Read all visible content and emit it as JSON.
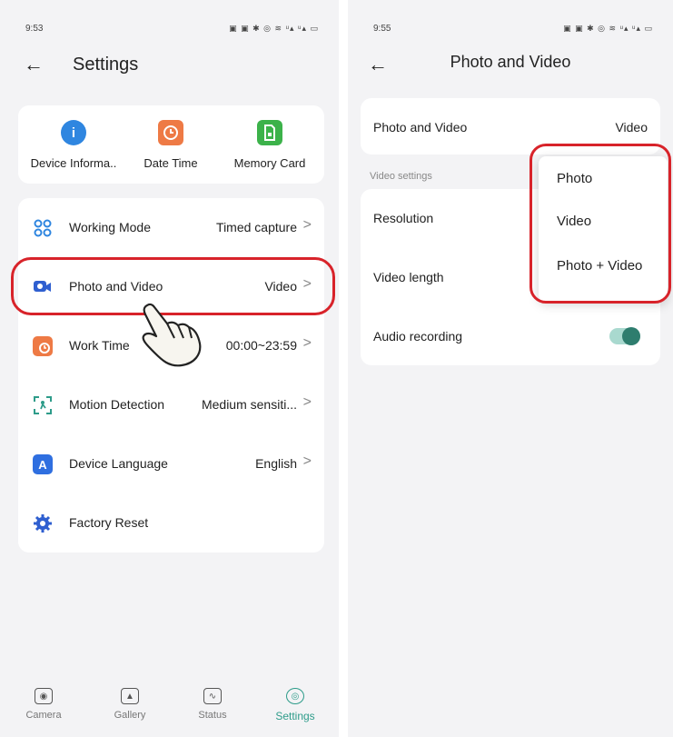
{
  "left": {
    "status": {
      "time": "9:53",
      "icons": "▣ ▣ ✱ ◎ ≋ ᵘ▴ ᵘ▴ ▭"
    },
    "header": {
      "title": "Settings"
    },
    "shortcuts": [
      {
        "label": "Device Informa..",
        "icon": "info-icon",
        "color": "#2f86e0"
      },
      {
        "label": "Date Time",
        "icon": "clock-icon",
        "color": "#ee7a45"
      },
      {
        "label": "Memory Card",
        "icon": "sd-card-icon",
        "color": "#3cb24a"
      }
    ],
    "rows": [
      {
        "label": "Working Mode",
        "value": "Timed capture",
        "icon": "grid-icon"
      },
      {
        "label": "Photo and Video",
        "value": "Video",
        "icon": "camera-icon"
      },
      {
        "label": "Work Time",
        "value": "00:00~23:59",
        "icon": "schedule-icon"
      },
      {
        "label": "Motion Detection",
        "value": "Medium sensiti...",
        "icon": "motion-icon"
      },
      {
        "label": "Device Language",
        "value": "English",
        "icon": "language-icon"
      },
      {
        "label": "Factory Reset",
        "value": "",
        "icon": "reset-gear-icon"
      }
    ],
    "nav": [
      {
        "label": "Camera",
        "icon": "camera-icon"
      },
      {
        "label": "Gallery",
        "icon": "gallery-icon"
      },
      {
        "label": "Status",
        "icon": "status-icon"
      },
      {
        "label": "Settings",
        "icon": "settings-icon",
        "active": true
      }
    ]
  },
  "right": {
    "status": {
      "time": "9:55",
      "icons": "▣ ▣ ✱ ◎ ≋ ᵘ▴ ᵘ▴ ▭"
    },
    "header": {
      "title": "Photo and Video"
    },
    "photo_video": {
      "label": "Photo and Video",
      "value": "Video"
    },
    "section_label": "Video settings",
    "rows": [
      {
        "label": "Resolution"
      },
      {
        "label": "Video length"
      },
      {
        "label": "Audio recording",
        "toggle_on": true
      }
    ],
    "dropdown": [
      "Photo",
      "Video",
      "Photo + Video"
    ]
  },
  "colors": {
    "accent": "#2e9c8a",
    "highlight": "#d8232a",
    "toggle": "#2e7d6e"
  }
}
